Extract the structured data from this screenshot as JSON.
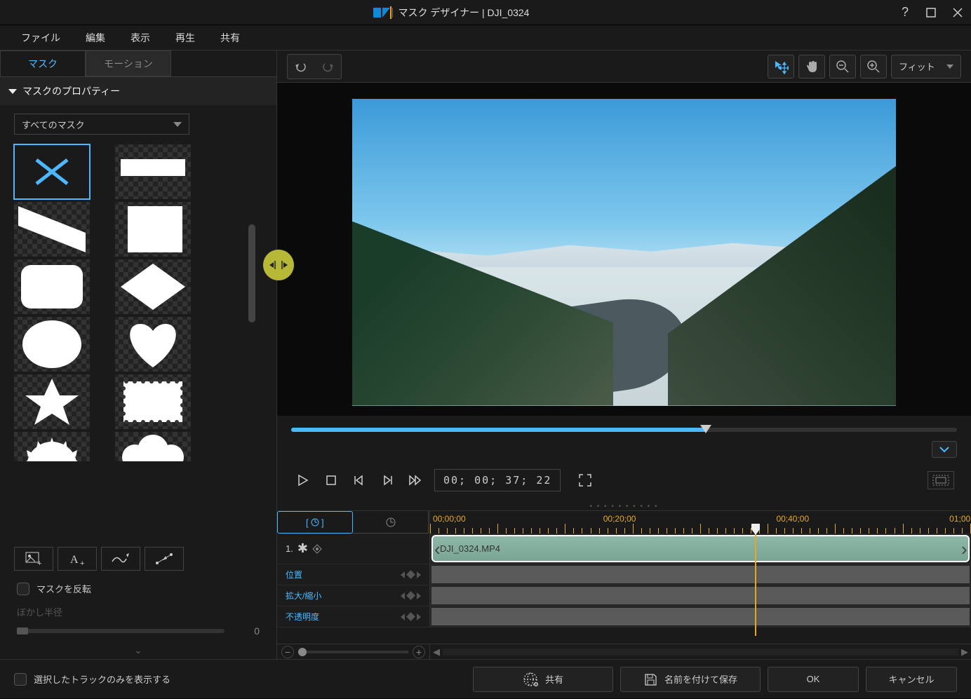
{
  "window": {
    "title": "マスク デザイナー   |   DJI_0324"
  },
  "menubar": {
    "file": "ファイル",
    "edit": "編集",
    "view": "表示",
    "playback": "再生",
    "share": "共有"
  },
  "tabs": {
    "mask": "マスク",
    "motion": "モーション"
  },
  "section": {
    "mask_properties": "マスクのプロパティー"
  },
  "dropdown": {
    "all_masks": "すべてのマスク"
  },
  "options": {
    "invert_mask": "マスクを反転",
    "blur_radius_label": "ぼかし半径",
    "blur_radius_value": "0"
  },
  "preview_toolbar": {
    "fit": "フィット"
  },
  "playback": {
    "timecode": "00; 00; 37; 22"
  },
  "timeline": {
    "ruler": {
      "t0": "00;00;00",
      "t1": "00;20;00",
      "t2": "00;40;00",
      "t3": "01;00"
    },
    "track_index": "1.",
    "clip_name": "DJI_0324.MP4",
    "rows": {
      "position": "位置",
      "scale": "拡大/縮小",
      "opacity": "不透明度"
    }
  },
  "footer": {
    "show_selected_only": "選択したトラックのみを表示する",
    "share": "共有",
    "save_as": "名前を付けて保存",
    "ok": "OK",
    "cancel": "キャンセル"
  }
}
